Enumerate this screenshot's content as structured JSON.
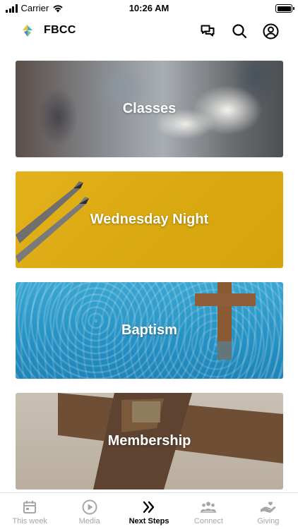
{
  "status_bar": {
    "carrier": "Carrier",
    "time": "10:26 AM"
  },
  "header": {
    "app_name": "FBCC",
    "icons": [
      "chat-bubbles-icon",
      "search-icon",
      "account-icon"
    ]
  },
  "cards": [
    {
      "label": "Classes"
    },
    {
      "label": "Wednesday Night"
    },
    {
      "label": "Baptism"
    },
    {
      "label": "Membership"
    }
  ],
  "tabbar": {
    "items": [
      {
        "label": "This week",
        "icon": "calendar-icon",
        "active": false
      },
      {
        "label": "Media",
        "icon": "play-icon",
        "active": false
      },
      {
        "label": "Next Steps",
        "icon": "double-chevron-icon",
        "active": true
      },
      {
        "label": "Connect",
        "icon": "group-icon",
        "active": false
      },
      {
        "label": "Giving",
        "icon": "giving-hand-icon",
        "active": false
      }
    ]
  },
  "colors": {
    "active_tab": "#000000",
    "inactive_tab": "#a6a6a6",
    "wednesday_card": "#d9a810",
    "baptism_card": "#2591c4"
  }
}
